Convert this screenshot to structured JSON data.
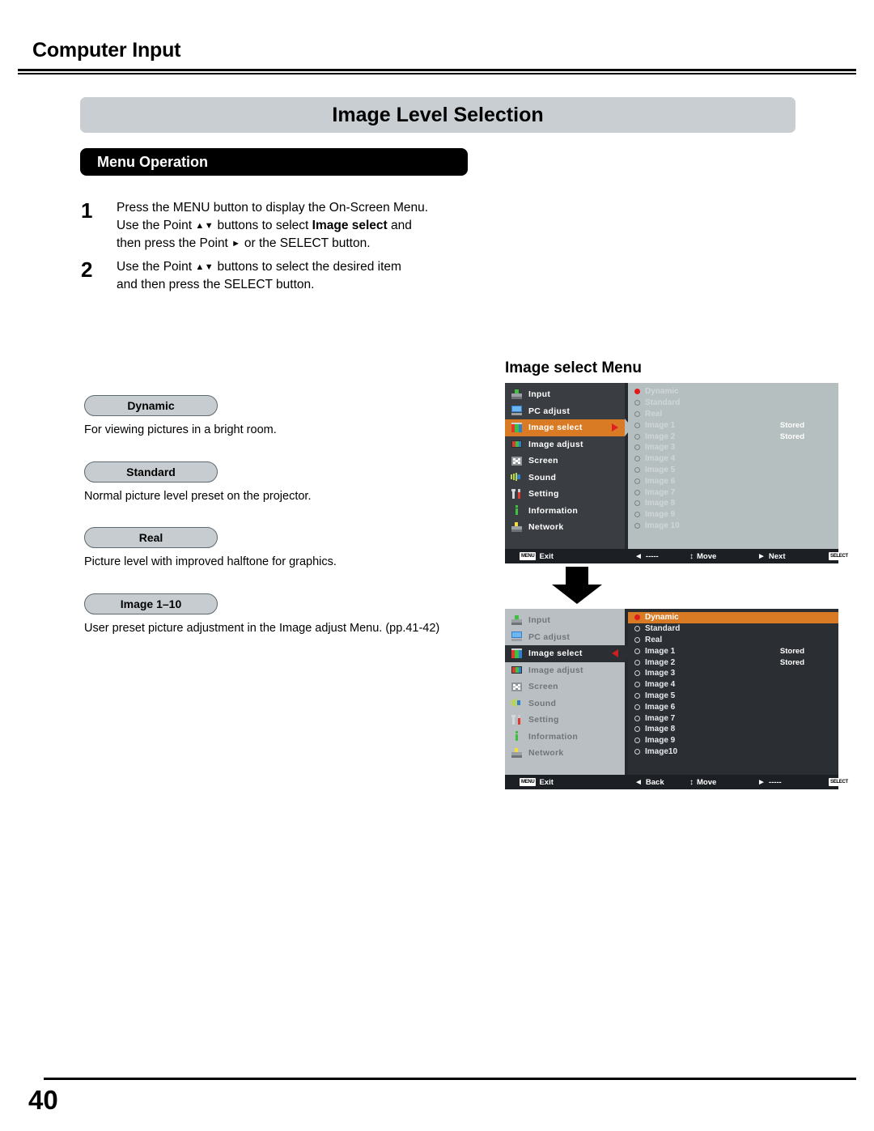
{
  "header": {
    "section": "Computer Input",
    "title": "Image Level Selection",
    "subsection": "Menu Operation"
  },
  "steps": [
    {
      "number": "1",
      "line1": "Press the MENU button to display the On-Screen Menu.",
      "line2_pre": "Use the Point ",
      "line2_glyphs": "▲▼",
      "line2_mid": " buttons to select ",
      "line2_bold": "Image select",
      "line2_post": " and",
      "line3_pre": "then press the Point ",
      "line3_glyph": "►",
      "line3_post": " or the SELECT button."
    },
    {
      "number": "2",
      "line1_pre": "Use the Point ",
      "line1_glyphs": "▲▼",
      "line1_post": " buttons to select the desired item",
      "line2": "and then press the SELECT button."
    }
  ],
  "definitions": [
    {
      "label": "Dynamic",
      "text": "For viewing pictures in a bright room."
    },
    {
      "label": "Standard",
      "text": "Normal picture level preset on the projector."
    },
    {
      "label": "Real",
      "text": "Picture level with improved halftone for graphics."
    },
    {
      "label": "Image 1–10",
      "text": "User preset picture adjustment in the Image adjust Menu. (pp.41-42)"
    }
  ],
  "osd": {
    "heading": "Image select Menu",
    "sidebar_items": [
      {
        "label": "Input",
        "icon": "input-icon"
      },
      {
        "label": "PC adjust",
        "icon": "pc-adjust-icon"
      },
      {
        "label": "Image select",
        "icon": "image-select-icon"
      },
      {
        "label": "Image adjust",
        "icon": "image-adjust-icon"
      },
      {
        "label": "Screen",
        "icon": "screen-icon"
      },
      {
        "label": "Sound",
        "icon": "sound-icon"
      },
      {
        "label": "Setting",
        "icon": "setting-icon"
      },
      {
        "label": "Information",
        "icon": "information-icon"
      },
      {
        "label": "Network",
        "icon": "network-icon"
      }
    ],
    "active_sidebar_index": 2,
    "top": {
      "rows": [
        {
          "label": "Dynamic",
          "selected": true,
          "stored": ""
        },
        {
          "label": "Standard",
          "selected": false,
          "stored": ""
        },
        {
          "label": "Real",
          "selected": false,
          "stored": ""
        },
        {
          "label": "Image 1",
          "selected": false,
          "stored": "Stored"
        },
        {
          "label": "Image 2",
          "selected": false,
          "stored": "Stored"
        },
        {
          "label": "Image 3",
          "selected": false,
          "stored": ""
        },
        {
          "label": "Image 4",
          "selected": false,
          "stored": ""
        },
        {
          "label": "Image 5",
          "selected": false,
          "stored": ""
        },
        {
          "label": "Image 6",
          "selected": false,
          "stored": ""
        },
        {
          "label": "Image 7",
          "selected": false,
          "stored": ""
        },
        {
          "label": "Image 8",
          "selected": false,
          "stored": ""
        },
        {
          "label": "Image 9",
          "selected": false,
          "stored": ""
        },
        {
          "label": "Image 10",
          "selected": false,
          "stored": ""
        }
      ],
      "status": [
        {
          "badge": "MENU",
          "glyph": "",
          "label": "Exit"
        },
        {
          "badge": "",
          "glyph": "◄",
          "label": "-----"
        },
        {
          "badge": "",
          "glyph": "↕",
          "label": "Move"
        },
        {
          "badge": "",
          "glyph": "►",
          "label": "Next"
        },
        {
          "badge": "SELECT",
          "glyph": "",
          "label": "Next"
        }
      ],
      "arrow_direction": "right"
    },
    "bottom": {
      "rows": [
        {
          "label": "Dynamic",
          "selected": true,
          "stored": ""
        },
        {
          "label": "Standard",
          "selected": false,
          "stored": ""
        },
        {
          "label": "Real",
          "selected": false,
          "stored": ""
        },
        {
          "label": "Image 1",
          "selected": false,
          "stored": "Stored"
        },
        {
          "label": "Image 2",
          "selected": false,
          "stored": "Stored"
        },
        {
          "label": "Image 3",
          "selected": false,
          "stored": ""
        },
        {
          "label": "Image 4",
          "selected": false,
          "stored": ""
        },
        {
          "label": "Image 5",
          "selected": false,
          "stored": ""
        },
        {
          "label": "Image 6",
          "selected": false,
          "stored": ""
        },
        {
          "label": "Image 7",
          "selected": false,
          "stored": ""
        },
        {
          "label": "Image 8",
          "selected": false,
          "stored": ""
        },
        {
          "label": "Image 9",
          "selected": false,
          "stored": ""
        },
        {
          "label": "Image10",
          "selected": false,
          "stored": ""
        }
      ],
      "status": [
        {
          "badge": "MENU",
          "glyph": "",
          "label": "Exit"
        },
        {
          "badge": "",
          "glyph": "◄",
          "label": "Back"
        },
        {
          "badge": "",
          "glyph": "↕",
          "label": "Move"
        },
        {
          "badge": "",
          "glyph": "►",
          "label": "-----"
        },
        {
          "badge": "SELECT",
          "glyph": "",
          "label": "Select"
        }
      ],
      "arrow_direction": "left"
    }
  },
  "footer": {
    "page_number": "40"
  },
  "colors": {
    "highlight_orange": "#d97a24",
    "panel_grey": "#b6bfc0",
    "panel_dark": "#2b2e33",
    "sidebar_dark": "#3a3d42",
    "sidebar_light": "#b9bfc2",
    "radio_on_red": "#e11b1b",
    "title_bar_grey": "#c8ced2"
  }
}
